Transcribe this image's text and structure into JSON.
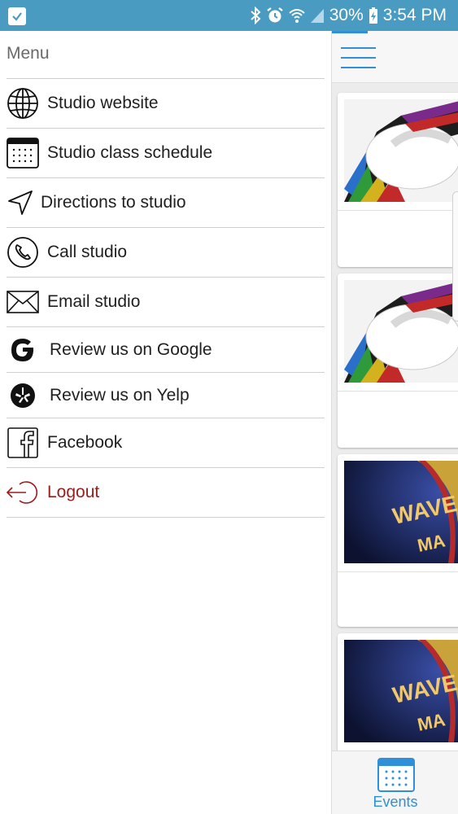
{
  "status_bar": {
    "battery": "30%",
    "time": "3:54 PM"
  },
  "drawer": {
    "title": "Menu",
    "items": [
      {
        "label": "Studio website",
        "icon": "globe-icon"
      },
      {
        "label": "Studio class schedule",
        "icon": "calendar-icon"
      },
      {
        "label": "Directions to studio",
        "icon": "navigation-arrow-icon"
      },
      {
        "label": "Call studio",
        "icon": "phone-icon"
      },
      {
        "label": "Email studio",
        "icon": "envelope-icon"
      },
      {
        "label": "Review us on Google",
        "icon": "google-icon"
      },
      {
        "label": "Review us on Yelp",
        "icon": "yelp-icon"
      },
      {
        "label": "Facebook",
        "icon": "facebook-icon"
      },
      {
        "label": "Logout",
        "icon": "logout-icon"
      }
    ]
  },
  "right_panel": {
    "bottom_nav": {
      "label": "Events",
      "icon": "calendar-icon"
    }
  },
  "colors": {
    "status_bar": "#4a9bc2",
    "accent": "#2f8fd8",
    "logout": "#9b1c1c"
  }
}
